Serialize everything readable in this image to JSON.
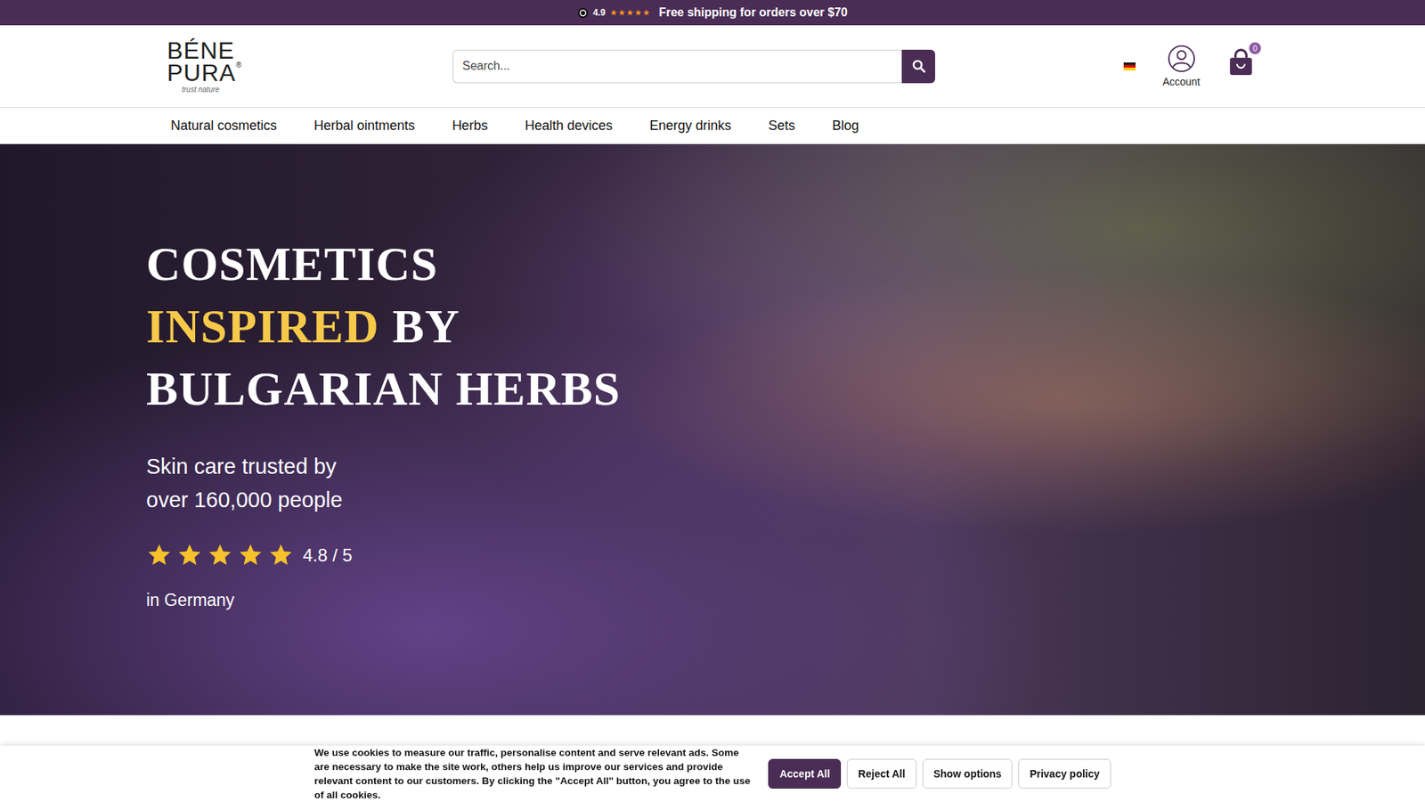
{
  "announcement": {
    "rating": "4.9",
    "stars": 5,
    "text": "Free shipping for orders over $70"
  },
  "logo": {
    "line1": "BÉNE",
    "line2": "PURA",
    "mark": "®",
    "tagline": "trust nature"
  },
  "search": {
    "placeholder": "Search..."
  },
  "account": {
    "label": "Account"
  },
  "cart": {
    "count": "0"
  },
  "nav": {
    "items": [
      "Natural cosmetics",
      "Herbal ointments",
      "Herbs",
      "Health devices",
      "Energy drinks",
      "Sets",
      "Blog"
    ]
  },
  "hero": {
    "title_lines": [
      [
        {
          "text": "COSMETICS",
          "highlight": false
        }
      ],
      [
        {
          "text": "INSPIRED",
          "highlight": true
        },
        {
          "text": "BY",
          "highlight": false
        }
      ],
      [
        {
          "text": "BULGARIAN HERBS",
          "highlight": false
        }
      ]
    ],
    "subtitle_lines": [
      "Skin care trusted by",
      "over 160,000 people"
    ],
    "rating": {
      "stars": 5,
      "score": "4.8 / 5"
    },
    "region": "in Germany"
  },
  "cookie_banner": {
    "text": "We use cookies to measure our traffic, personalise content and serve relevant ads. Some are necessary to make the site work, others help us improve our services and provide relevant content to our customers. By clicking the \"Accept All\" button, you agree to the use of all cookies.",
    "buttons": [
      {
        "label": "Accept All",
        "primary": true
      },
      {
        "label": "Reject All",
        "primary": false
      },
      {
        "label": "Show options",
        "primary": false
      },
      {
        "label": "Privacy policy",
        "primary": false
      }
    ]
  }
}
